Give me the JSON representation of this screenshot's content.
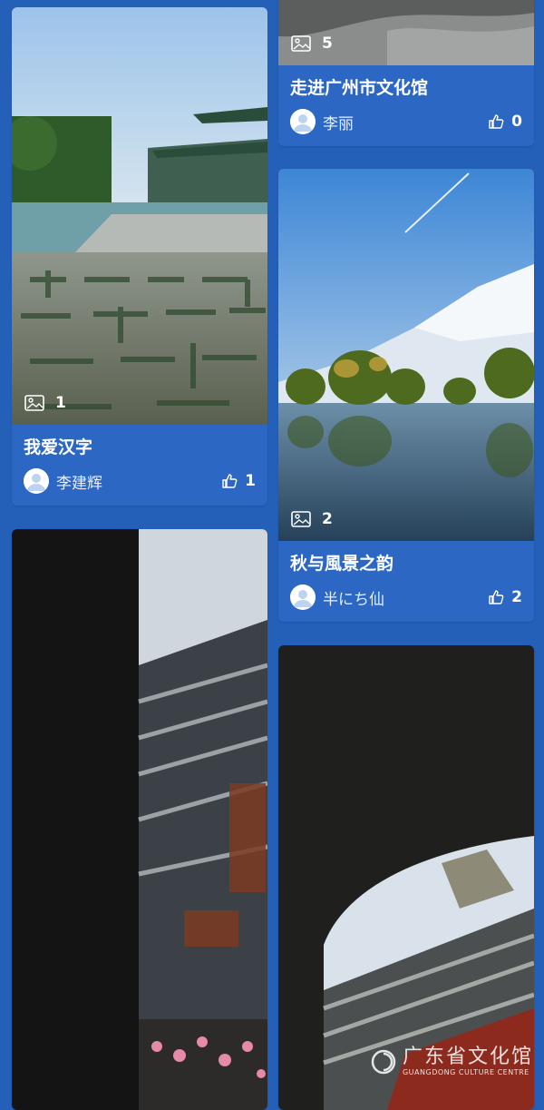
{
  "cards": [
    {
      "title": "我爱汉字",
      "author": "李建辉",
      "likes": "1",
      "image_count": "1",
      "scene": "hanzi-plaza-icon"
    },
    {
      "title": "走进广州市文化馆",
      "author": "李丽",
      "likes": "0",
      "image_count": "5",
      "scene": "stone-wall-icon"
    },
    {
      "title": "秋与風景之韵",
      "author": "半にち仙",
      "likes": "2",
      "image_count": "2",
      "scene": "lake-mountain-icon"
    },
    {
      "title": "",
      "author": "",
      "likes": "",
      "image_count": "",
      "scene": "temple-roof-icon"
    },
    {
      "title": "",
      "author": "",
      "likes": "",
      "image_count": "",
      "scene": "temple-arch-icon"
    }
  ],
  "watermark": {
    "cn": "广东省文化馆",
    "en": "GUANGDONG CULTURE CENTRE"
  },
  "colors": {
    "background": "#2560b8",
    "card": "#2b67c3"
  }
}
